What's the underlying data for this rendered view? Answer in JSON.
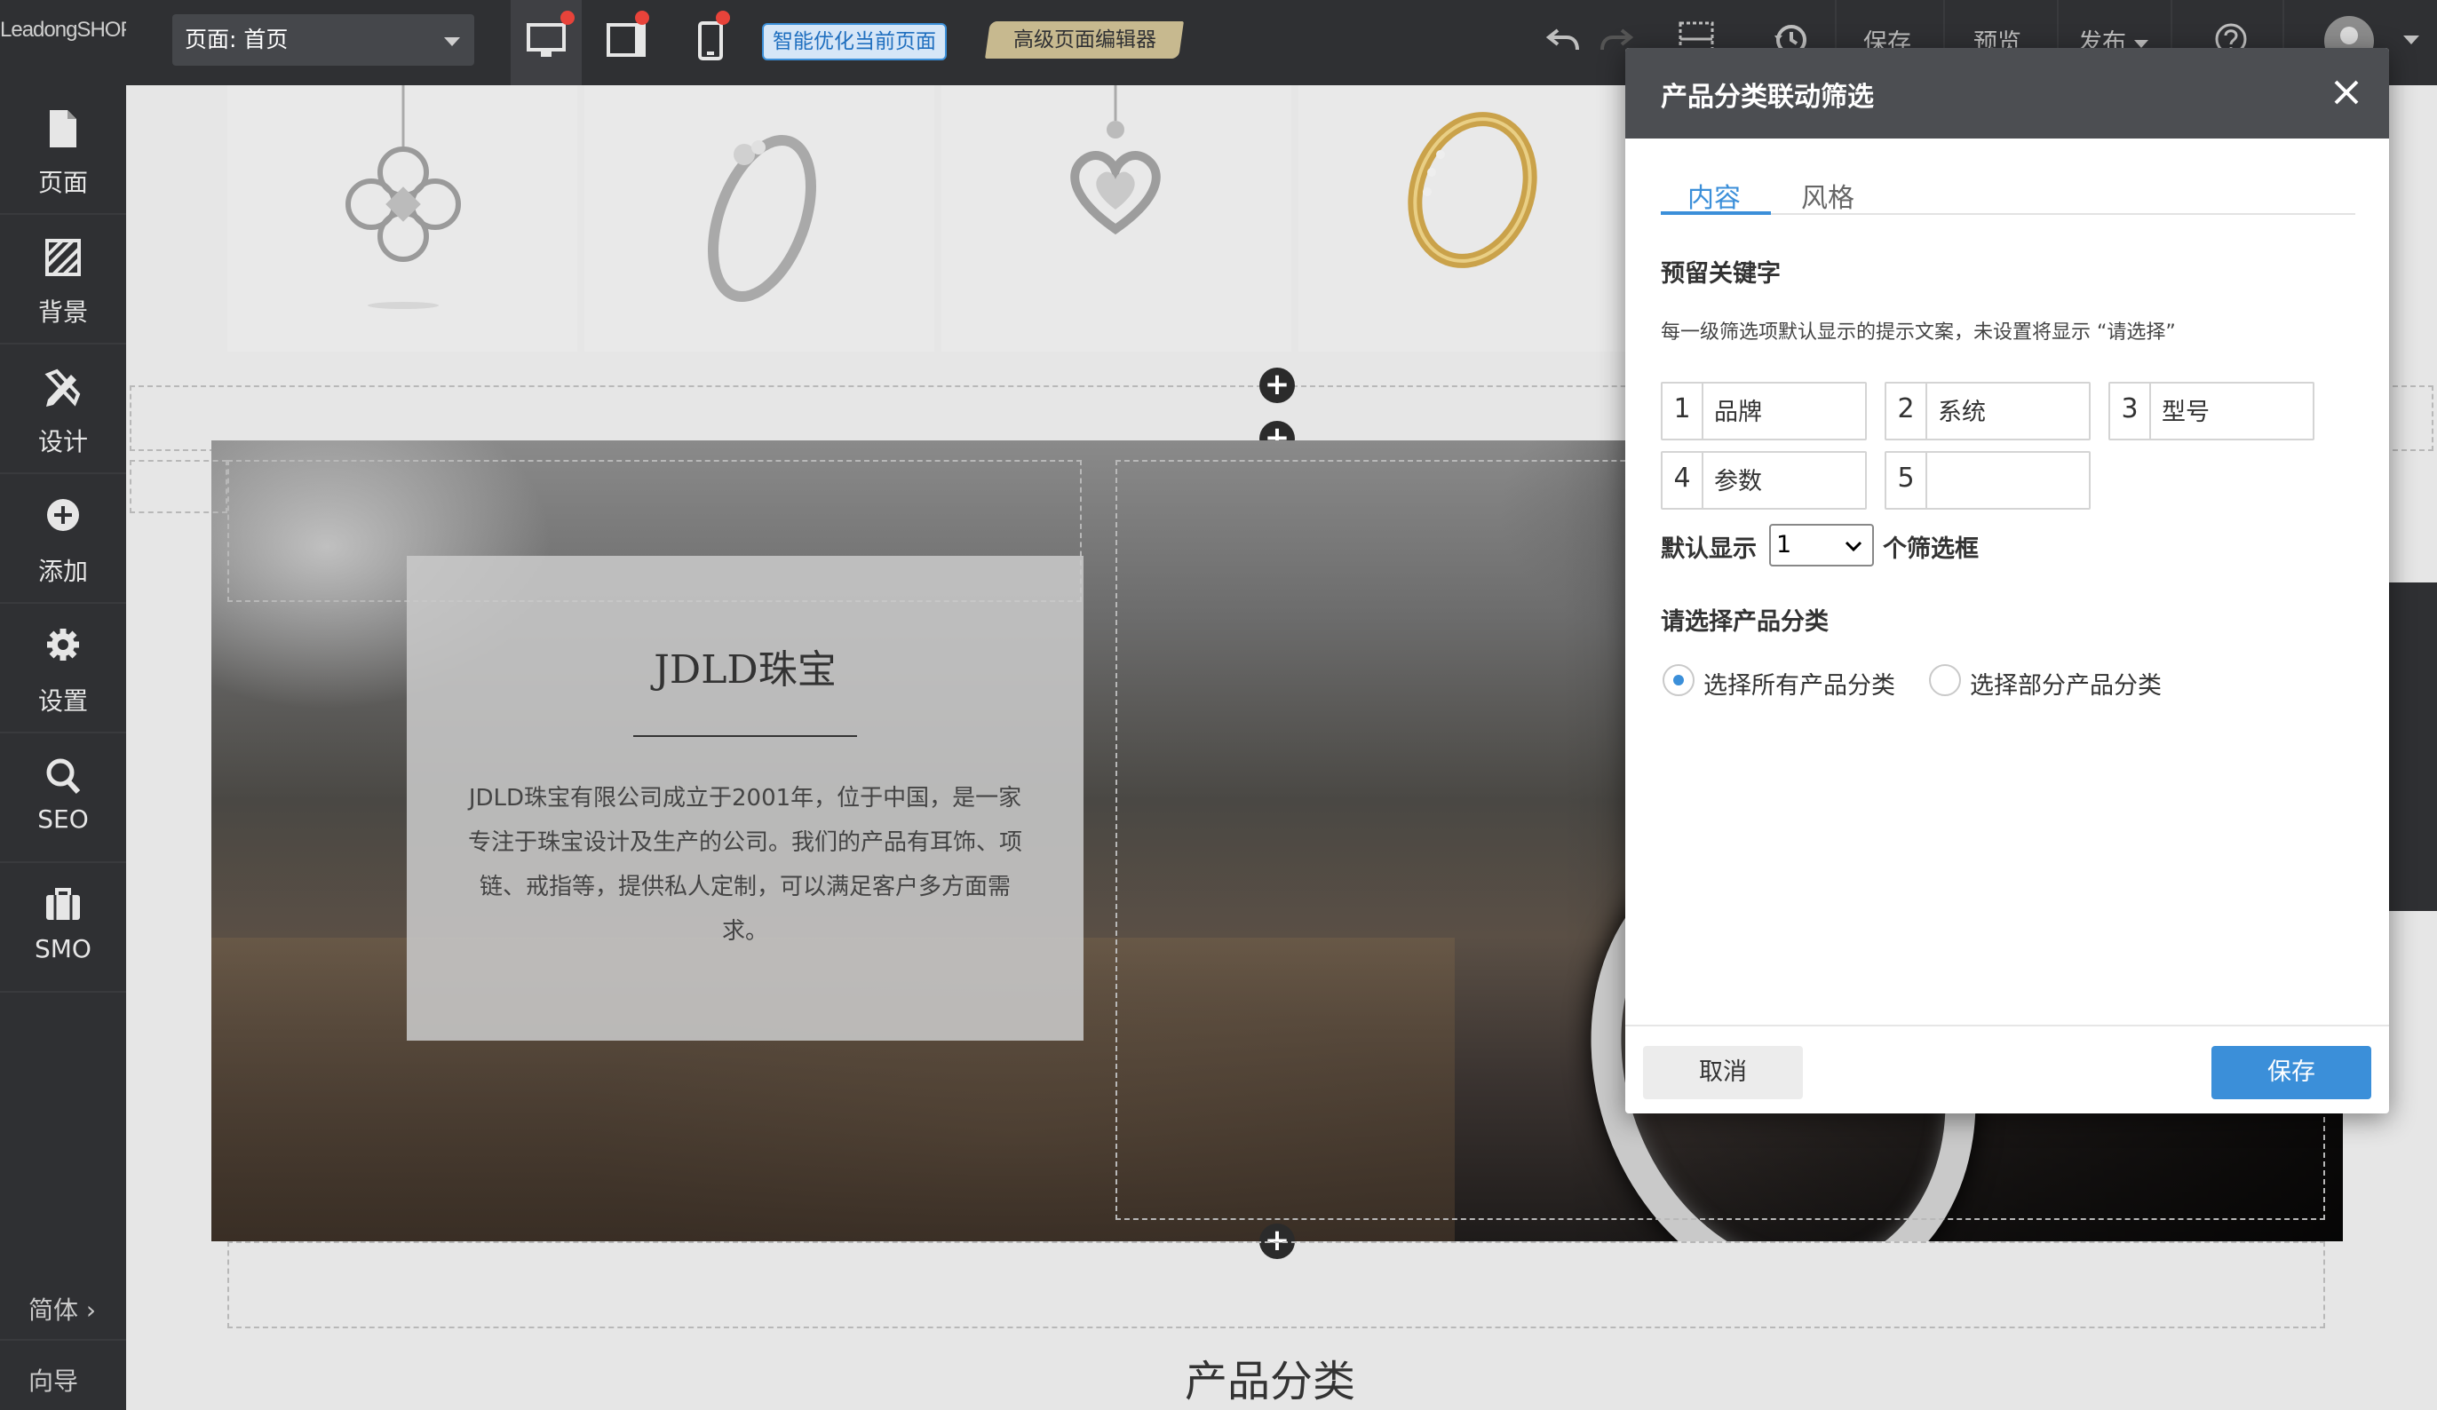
{
  "topbar": {
    "logo": "LeadongSHOP",
    "page_select": "页面:  首页",
    "smart_optimize": "智能优化当前页面",
    "advanced_editor": "高级页面编辑器",
    "save": "保存",
    "preview": "预览",
    "publish": "发布"
  },
  "sidebar": {
    "items": [
      {
        "label": "页面"
      },
      {
        "label": "背景"
      },
      {
        "label": "设计"
      },
      {
        "label": "添加"
      },
      {
        "label": "设置"
      },
      {
        "label": "SEO"
      },
      {
        "label": "SMO"
      }
    ],
    "language": "简体  ›",
    "guide": "向导"
  },
  "canvas": {
    "about_title": "JDLD珠宝",
    "about_text": "JDLD珠宝有限公司成立于2001年，位于中国，是一家专注于珠宝设计及生产的公司。我们的产品有耳饰、项链、戒指等，提供私人定制，可以满足客户多方面需求。",
    "category_title": "产品分类",
    "plus": "+"
  },
  "modal": {
    "title": "产品分类联动筛选",
    "tabs": [
      {
        "label": "内容",
        "active": true
      },
      {
        "label": "风格",
        "active": false
      }
    ],
    "keyword_heading": "预留关键字",
    "keyword_hint": "每一级筛选项默认显示的提示文案，未设置将显示 “请选择”",
    "keywords": [
      {
        "num": "1",
        "value": "品牌"
      },
      {
        "num": "2",
        "value": "系统"
      },
      {
        "num": "3",
        "value": "型号"
      },
      {
        "num": "4",
        "value": "参数"
      },
      {
        "num": "5",
        "value": ""
      }
    ],
    "default_label": "默认显示",
    "default_value": "1",
    "default_suffix": "个筛选框",
    "category_heading": "请选择产品分类",
    "radio_all": "选择所有产品分类",
    "radio_part": "选择部分产品分类",
    "cancel": "取消",
    "save": "保存"
  },
  "colors": {
    "accent": "#3b8fd9",
    "topbar_bg": "#2f3033",
    "modal_header": "#4c4e52",
    "notify_dot": "#e8433a"
  }
}
